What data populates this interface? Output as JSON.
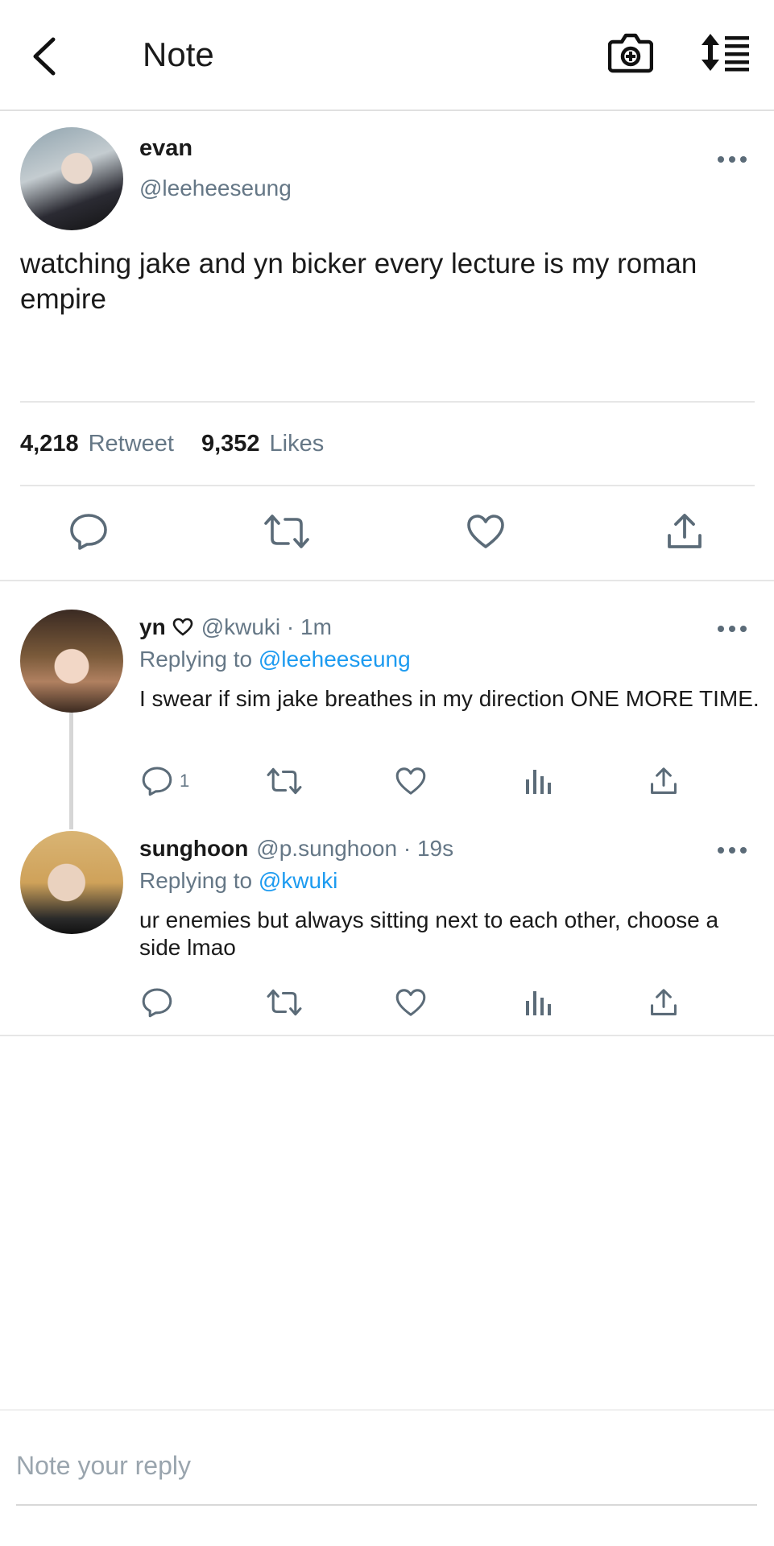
{
  "header": {
    "title": "Note",
    "back_icon": "chevron-left-icon",
    "camera_icon": "camera-plus-icon",
    "sort_icon": "sort-list-icon"
  },
  "post": {
    "name": "evan",
    "handle": "@leeheeseung",
    "text": "watching jake and yn bicker every lecture is my roman empire",
    "retweet_count": "4,218",
    "retweet_label": "Retweet",
    "likes_count": "9,352",
    "likes_label": "Likes"
  },
  "replies": [
    {
      "name": "yn",
      "badge_icon": "heart-outline-icon",
      "handle": "@kwuki · 1m",
      "replying_prefix": "Replying to",
      "replying_to": "@leeheeseung",
      "text": "I swear if sim jake breathes in my direction ONE MORE TIME.",
      "reply_count": "1"
    },
    {
      "name": "sunghoon",
      "handle": "@p.sunghoon · 19s",
      "replying_prefix": "Replying to",
      "replying_to": "@kwuki",
      "text": "ur enemies but always sitting next to each other, choose a side lmao",
      "reply_count": ""
    }
  ],
  "composer": {
    "placeholder": "Note your reply"
  },
  "colors": {
    "accent": "#1d9bf0",
    "secondary_text": "#657786",
    "icon": "#5b6b78"
  }
}
